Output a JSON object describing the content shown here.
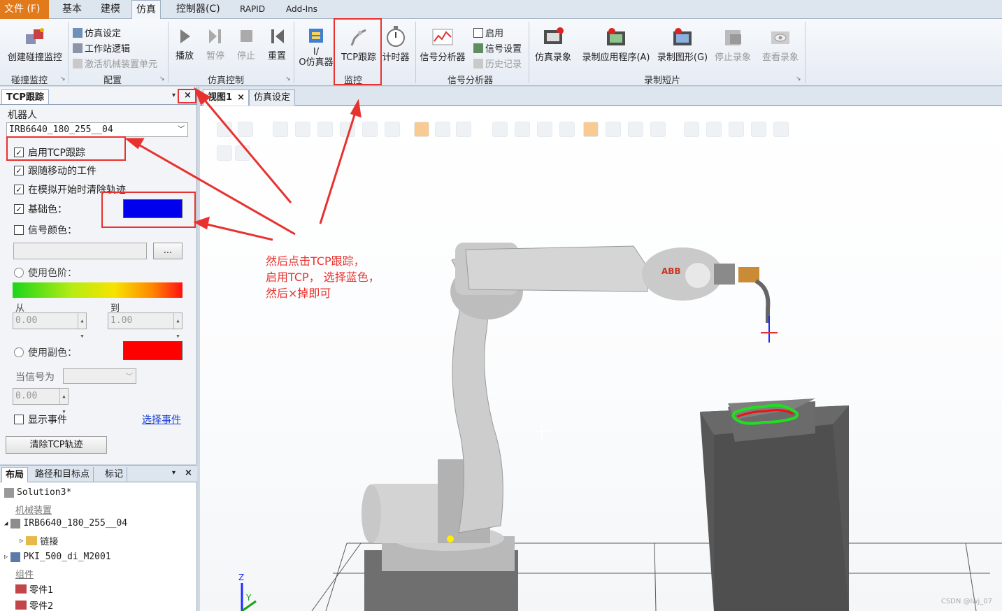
{
  "ribbon_tabs": [
    "文件 (F)",
    "基本",
    "建模",
    "仿真",
    "控制器(C)",
    "RAPID",
    "Add-Ins"
  ],
  "ribbon": {
    "collision": {
      "button": "创建碰撞监控",
      "group": "碰撞监控"
    },
    "config": {
      "items": [
        "仿真设定",
        "工作站逻辑",
        "激活机械装置单元"
      ],
      "group": "配置"
    },
    "sim_control": {
      "buttons": [
        "播放",
        "暂停",
        "停止",
        "重置"
      ],
      "group": "仿真控制"
    },
    "io_sim": {
      "label_line1": "I/",
      "label_line2": "O仿真器"
    },
    "monitor": {
      "buttons": [
        "TCP跟踪",
        "计时器"
      ],
      "group": "监控"
    },
    "signal_analyzer": {
      "button": "信号分析器",
      "items": [
        "启用",
        "信号设置",
        "历史记录"
      ],
      "group": "信号分析器"
    },
    "record": {
      "buttons": [
        "仿真录象",
        "录制应用程序(A)",
        "录制图形(G)",
        "停止录象",
        "查看录象"
      ],
      "group": "录制短片"
    }
  },
  "tcp_panel": {
    "tab_title": "TCP跟踪",
    "robot_label": "机器人",
    "robot_value": "IRB6640_180_255__04",
    "enable_tcp": "启用TCP跟踪",
    "follow_workpiece": "跟随移动的工件",
    "clear_on_start": "在模拟开始时清除轨迹",
    "base_color_label": "基础色：",
    "base_color": "#0000ee",
    "signal_color_label": "信号颜色：",
    "browse_button": "...",
    "use_color_scale": "使用色阶：",
    "from_label": "从",
    "to_label": "到",
    "from_value": "0.00",
    "to_value": "1.00",
    "use_secondary_color": "使用副色：",
    "secondary_color": "#ff0000",
    "when_signal_label": "当信号为",
    "signal_value": "0.00",
    "show_events": "显示事件",
    "select_events": "选择事件",
    "clear_button": "清除TCP轨迹"
  },
  "bottom_panel": {
    "tabs": [
      "布局",
      "路径和目标点",
      "标记"
    ],
    "tree": {
      "solution": "Solution3*",
      "mechanisms_category": "机械装置",
      "robot": "IRB6640_180_255__04",
      "links": "链接",
      "tool": "PKI_500_di_M2001",
      "components_category": "组件",
      "parts": [
        "零件1",
        "零件2"
      ]
    }
  },
  "document_tabs": [
    "视图1",
    "仿真设定"
  ],
  "annotation": [
    "然后点击TCP跟踪，",
    "启用TCP，   选择蓝色，",
    "然后×掉即可"
  ],
  "robot_brand": "ABB",
  "axis_labels": {
    "z": "Z",
    "y": "Y"
  },
  "watermark": "CSDN @lwj_07",
  "colors": {
    "file_tab": "#e07a1a",
    "annotation": "#e8322f",
    "trail_green": "#22dd22",
    "trail_red": "#ee1111"
  }
}
